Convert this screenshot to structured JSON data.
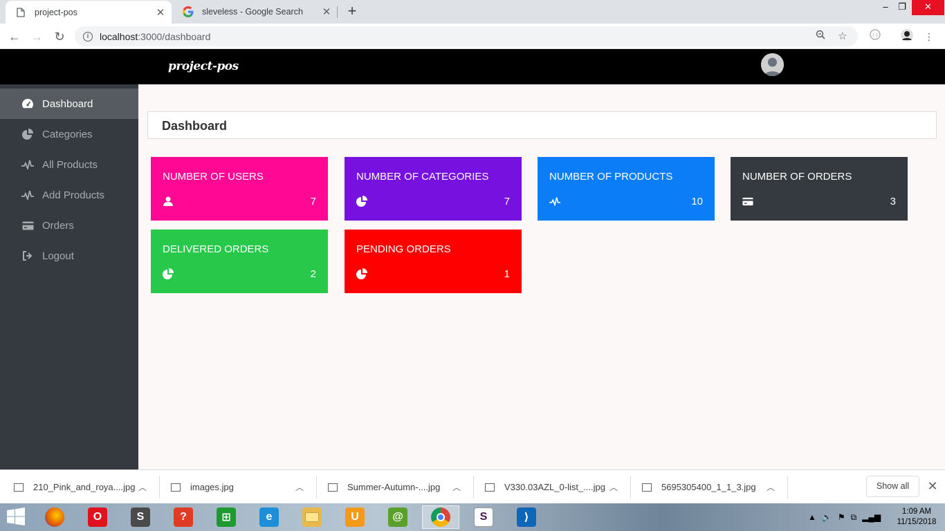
{
  "browser": {
    "tabs": [
      {
        "title": "project-pos",
        "icon": "page-icon",
        "active": true
      },
      {
        "title": "sleveless - Google Search",
        "icon": "google-icon",
        "active": false
      }
    ],
    "new_tab_label": "+",
    "window_controls": {
      "minimize": "–",
      "restore": "❐",
      "close": "✕"
    },
    "back": "←",
    "forward": "→",
    "reload": "↻",
    "url_host": "localhost",
    "url_path": ":3000/dashboard"
  },
  "app": {
    "brand": "project-pos"
  },
  "sidebar": {
    "items": [
      {
        "label": "Dashboard",
        "icon": "dashboard-gauge-icon",
        "active": true
      },
      {
        "label": "Categories",
        "icon": "pie-chart-icon",
        "active": false
      },
      {
        "label": "All Products",
        "icon": "heartbeat-icon",
        "active": false
      },
      {
        "label": "Add Products",
        "icon": "heartbeat-icon",
        "active": false
      },
      {
        "label": "Orders",
        "icon": "credit-card-icon",
        "active": false
      },
      {
        "label": "Logout",
        "icon": "sign-out-icon",
        "active": false
      }
    ]
  },
  "main": {
    "title": "Dashboard",
    "cards": [
      {
        "label": "NUMBER OF USERS",
        "value": "7",
        "icon": "user-icon",
        "color": "#ff0893"
      },
      {
        "label": "NUMBER OF CATEGORIES",
        "value": "7",
        "icon": "pie-chart-icon",
        "color": "#7711e0"
      },
      {
        "label": "NUMBER OF PRODUCTS",
        "value": "10",
        "icon": "heartbeat-icon",
        "color": "#0b7df7"
      },
      {
        "label": "NUMBER OF ORDERS",
        "value": "3",
        "icon": "credit-card-icon",
        "color": "#343a40"
      },
      {
        "label": "DELIVERED ORDERS",
        "value": "2",
        "icon": "pie-chart-icon",
        "color": "#28c94a"
      },
      {
        "label": "PENDING ORDERS",
        "value": "1",
        "icon": "pie-chart-icon",
        "color": "#fe0000"
      }
    ]
  },
  "downloads": {
    "items": [
      {
        "name": "210_Pink_and_roya....jpg"
      },
      {
        "name": "images.jpg"
      },
      {
        "name": "Summer-Autumn-....jpg"
      },
      {
        "name": "V330.03AZL_0-list_....jpg"
      },
      {
        "name": "5695305400_1_1_3.jpg"
      }
    ],
    "show_all": "Show all",
    "close": "✕"
  },
  "taskbar": {
    "apps": [
      {
        "name": "firefox-icon",
        "color": "#e66000",
        "glyph": ""
      },
      {
        "name": "opera-icon",
        "color": "#e0121d",
        "glyph": "O"
      },
      {
        "name": "sublime-text-icon",
        "color": "#4a4a4a",
        "glyph": "S"
      },
      {
        "name": "help-icon",
        "color": "#e03b24",
        "glyph": "?"
      },
      {
        "name": "store-icon",
        "color": "#1d9b2f",
        "glyph": "⊞"
      },
      {
        "name": "internet-explorer-icon",
        "color": "#1f8ed8",
        "glyph": "e"
      },
      {
        "name": "file-explorer-icon",
        "color": "#e8b84a",
        "glyph": ""
      },
      {
        "name": "uc-browser-icon",
        "color": "#f39a1b",
        "glyph": "U"
      },
      {
        "name": "chameleon-icon",
        "color": "#5aa02c",
        "glyph": "@"
      },
      {
        "name": "chrome-icon",
        "color": "#db4437",
        "glyph": ""
      },
      {
        "name": "slack-icon",
        "color": "#ffffff",
        "glyph": "S"
      },
      {
        "name": "vscode-icon",
        "color": "#0e66b8",
        "glyph": "⟩"
      }
    ],
    "time": "1:09 AM",
    "date": "11/15/2018"
  }
}
